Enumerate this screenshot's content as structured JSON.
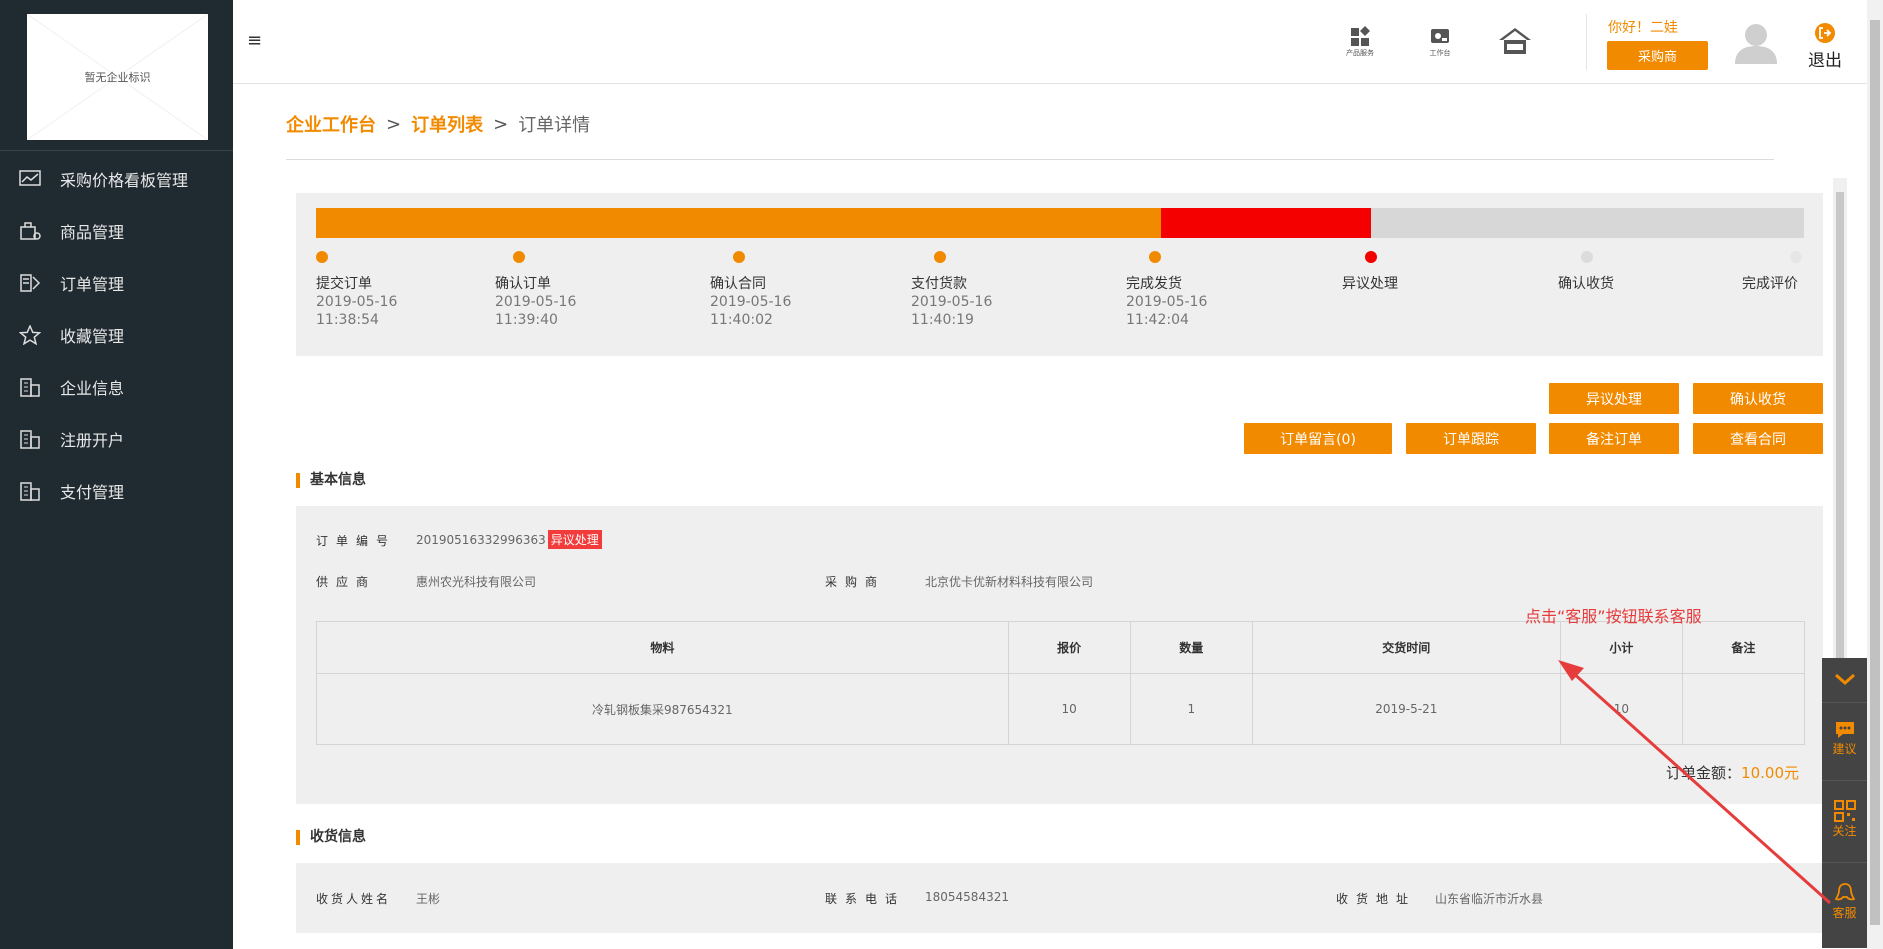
{
  "sidebar": {
    "logo_text": "暂无企业标识",
    "items": [
      {
        "label": "采购价格看板管理",
        "icon": "chart-icon"
      },
      {
        "label": "商品管理",
        "icon": "goods-icon"
      },
      {
        "label": "订单管理",
        "icon": "order-icon"
      },
      {
        "label": "收藏管理",
        "icon": "star-icon"
      },
      {
        "label": "企业信息",
        "icon": "building-icon"
      },
      {
        "label": "注册开户",
        "icon": "building-icon"
      },
      {
        "label": "支付管理",
        "icon": "building-icon"
      }
    ]
  },
  "topbar": {
    "menu_icon": "≡",
    "icons": [
      {
        "label": "产品服务",
        "icon": "product-service-icon"
      },
      {
        "label": "工作台",
        "icon": "workbench-icon"
      },
      {
        "label": "",
        "icon": "home-icon"
      }
    ],
    "greeting": "你好！二娃",
    "role_button": "采购商",
    "logout": "退出"
  },
  "breadcrumb": {
    "items": [
      "企业工作台",
      "订单列表"
    ],
    "separator": ">",
    "current": "订单详情"
  },
  "progress": {
    "completed_fraction": 0.568,
    "exception_fraction": 0.141,
    "steps": [
      {
        "label": "提交订单",
        "date": "2019-05-16",
        "time": "11:38:54",
        "state": "done"
      },
      {
        "label": "确认订单",
        "date": "2019-05-16",
        "time": "11:39:40",
        "state": "done"
      },
      {
        "label": "确认合同",
        "date": "2019-05-16",
        "time": "11:40:02",
        "state": "done"
      },
      {
        "label": "支付货款",
        "date": "2019-05-16",
        "time": "11:40:19",
        "state": "done"
      },
      {
        "label": "完成发货",
        "date": "2019-05-16",
        "time": "11:42:04",
        "state": "done"
      },
      {
        "label": "异议处理",
        "date": "",
        "time": "",
        "state": "exception"
      },
      {
        "label": "确认收货",
        "date": "",
        "time": "",
        "state": "pending"
      },
      {
        "label": "完成评价",
        "date": "",
        "time": "",
        "state": "pending"
      }
    ]
  },
  "actions": {
    "dispute": "异议处理",
    "confirm_receipt": "确认收货",
    "message": "订单留言(0)",
    "tracking": "订单跟踪",
    "remark": "备注订单",
    "contract": "查看合同"
  },
  "basic_info": {
    "title": "基本信息",
    "order_no_label": "订单编号",
    "order_no": "20190516332996363",
    "order_status": "异议处理",
    "supplier_label": "供应商",
    "supplier": "惠州农光科技有限公司",
    "buyer_label": "采购商",
    "buyer": "北京优卡优新材料科技有限公司",
    "table": {
      "headers": [
        "物料",
        "报价",
        "数量",
        "交货时间",
        "小计",
        "备注"
      ],
      "rows": [
        [
          "冷轧钢板集采987654321",
          "10",
          "1",
          "2019-5-21",
          "10",
          ""
        ]
      ]
    },
    "total_label": "订单金额：",
    "total_value": "10.00元"
  },
  "annotation": "点击“客服”按钮联系客服",
  "receiving": {
    "title": "收货信息",
    "name_label": "收货人姓名",
    "name": "王彬",
    "phone_label": "联系电话",
    "phone": "18054584321",
    "address_label": "收货地址",
    "address": "山东省临沂市沂水县"
  },
  "float_panel": {
    "suggest": "建议",
    "follow": "关注",
    "service": "客服"
  },
  "colors": {
    "accent": "#f28a00",
    "exception": "#f50000",
    "sidebar_bg": "#1f2a31"
  }
}
